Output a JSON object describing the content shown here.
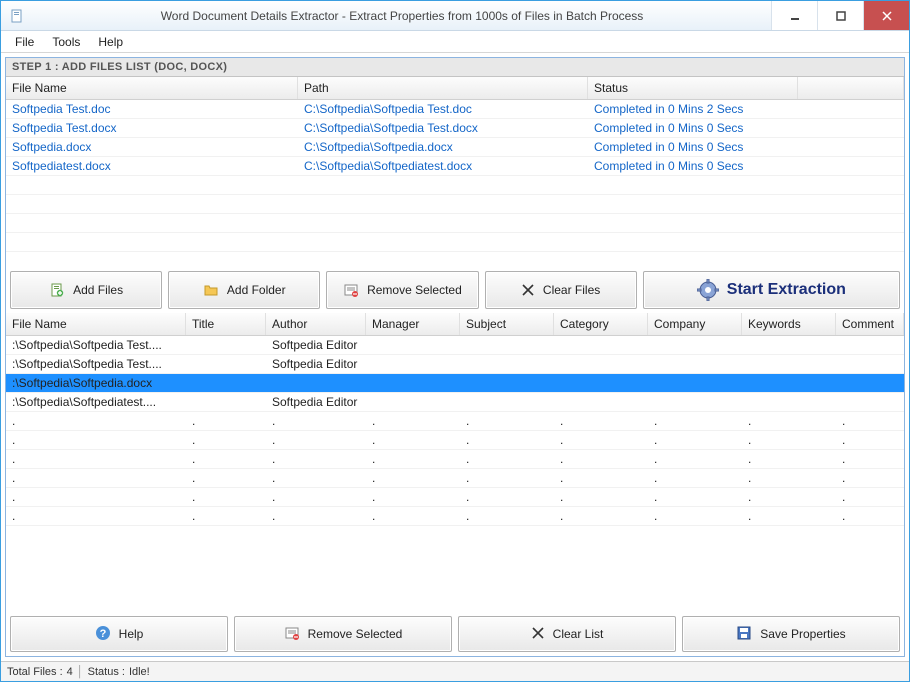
{
  "window": {
    "title": "Word Document Details Extractor - Extract Properties from 1000s of Files in Batch Process"
  },
  "menu": {
    "file": "File",
    "tools": "Tools",
    "help": "Help"
  },
  "step_header": "STEP 1 : ADD FILES LIST (DOC, DOCX)",
  "grid1": {
    "cols": {
      "fileName": "File Name",
      "path": "Path",
      "status": "Status"
    },
    "rows": [
      {
        "fileName": "Softpedia Test.doc",
        "path": "C:\\Softpedia\\Softpedia Test.doc",
        "status": "Completed in 0 Mins 2 Secs"
      },
      {
        "fileName": "Softpedia Test.docx",
        "path": "C:\\Softpedia\\Softpedia Test.docx",
        "status": "Completed in 0 Mins 0 Secs"
      },
      {
        "fileName": "Softpedia.docx",
        "path": "C:\\Softpedia\\Softpedia.docx",
        "status": "Completed in 0 Mins 0 Secs"
      },
      {
        "fileName": "Softpediatest.docx",
        "path": "C:\\Softpedia\\Softpediatest.docx",
        "status": "Completed in 0 Mins 0 Secs"
      }
    ]
  },
  "toolbar": {
    "addFiles": "Add Files",
    "addFolder": "Add Folder",
    "removeSelected": "Remove Selected",
    "clearFiles": "Clear Files",
    "startExtraction": "Start Extraction"
  },
  "grid2": {
    "cols": {
      "fileName": "File Name",
      "title": "Title",
      "author": "Author",
      "manager": "Manager",
      "subject": "Subject",
      "category": "Category",
      "company": "Company",
      "keywords": "Keywords",
      "comment": "Comment"
    },
    "rows": [
      {
        "fileName": ":\\Softpedia\\Softpedia Test....",
        "title": "",
        "author": "Softpedia Editor",
        "manager": "",
        "subject": "",
        "category": "",
        "company": "",
        "keywords": "",
        "comment": "",
        "selected": false
      },
      {
        "fileName": ":\\Softpedia\\Softpedia Test....",
        "title": "",
        "author": "Softpedia Editor",
        "manager": "",
        "subject": "",
        "category": "",
        "company": "",
        "keywords": "",
        "comment": "",
        "selected": false
      },
      {
        "fileName": ":\\Softpedia\\Softpedia.docx",
        "title": "",
        "author": "",
        "manager": "",
        "subject": "",
        "category": "",
        "company": "",
        "keywords": "",
        "comment": "",
        "selected": true
      },
      {
        "fileName": ":\\Softpedia\\Softpediatest....",
        "title": "",
        "author": "Softpedia Editor",
        "manager": "",
        "subject": "",
        "category": "",
        "company": "",
        "keywords": "",
        "comment": "",
        "selected": false
      }
    ]
  },
  "bottombar": {
    "help": "Help",
    "removeSelected": "Remove Selected",
    "clearList": "Clear List",
    "saveProperties": "Save Properties"
  },
  "status": {
    "totalFilesLabel": "Total Files :",
    "totalFiles": "4",
    "statusLabel": "Status :",
    "statusValue": "Idle!"
  }
}
